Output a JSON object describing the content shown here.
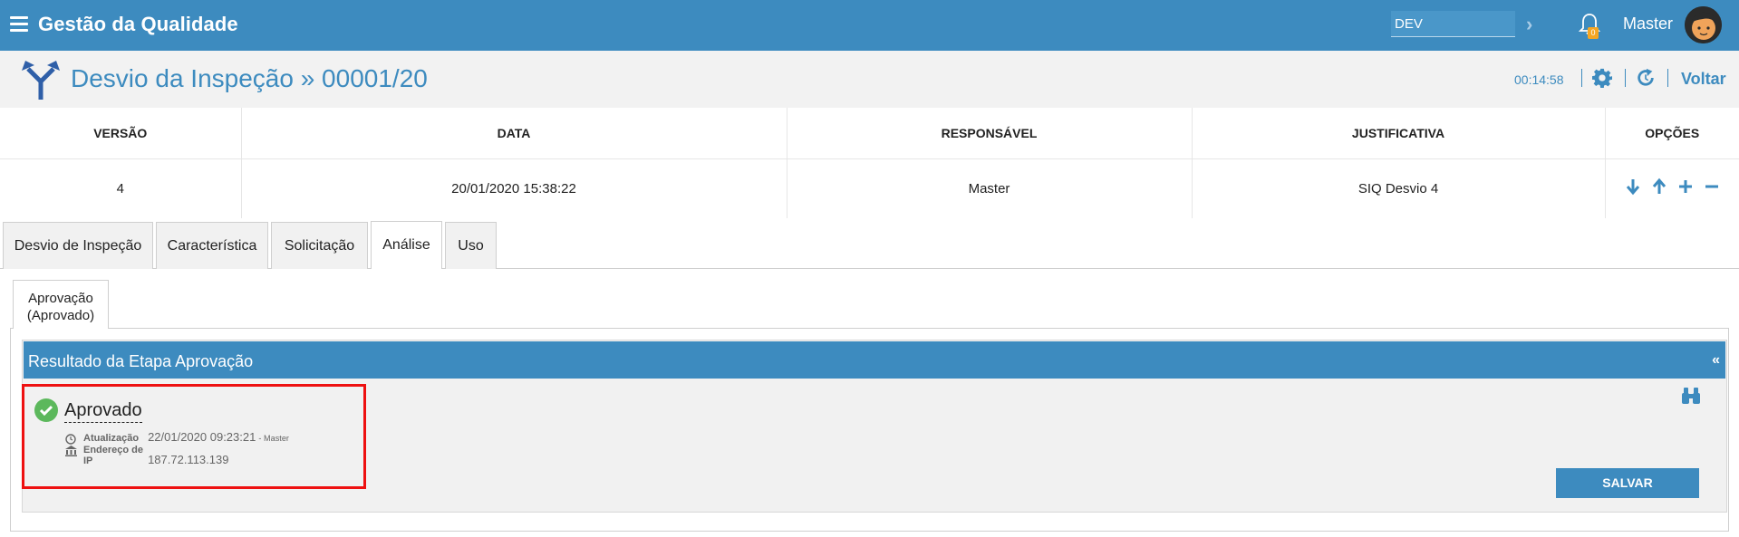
{
  "header": {
    "app_title": "Gestão da Qualidade",
    "environment": "DEV",
    "notification_count": "0",
    "user_name": "Master"
  },
  "page": {
    "title": "Desvio da Inspeção » 00001/20",
    "timer": "00:14:58",
    "back_label": "Voltar"
  },
  "versions_table": {
    "columns": [
      "VERSÃO",
      "DATA",
      "RESPONSÁVEL",
      "JUSTIFICATIVA",
      "OPÇÕES"
    ],
    "rows": [
      {
        "version": "4",
        "date": "20/01/2020 15:38:22",
        "responsible": "Master",
        "justification": "SIQ Desvio 4"
      }
    ]
  },
  "tabs": [
    {
      "label": "Desvio de Inspeção",
      "active": false
    },
    {
      "label": "Característica",
      "active": false
    },
    {
      "label": "Solicitação",
      "active": false
    },
    {
      "label": "Análise",
      "active": true
    },
    {
      "label": "Uso",
      "active": false
    }
  ],
  "subtab": {
    "line1": "Aprovação",
    "line2": "(Aprovado)"
  },
  "result": {
    "title": "Resultado da Etapa Aprovação",
    "collapse_label": "«",
    "status": "Aprovado",
    "update_label": "Atualização",
    "update_value": "22/01/2020 09:23:21",
    "update_user": "- Master",
    "ip_label": "Endereço de IP",
    "ip_value": "187.72.113.139",
    "save_label": "SALVAR"
  },
  "colors": {
    "primary": "#3d8bbf",
    "success": "#5cb85c",
    "highlight": "#ee1111",
    "badge": "#f5a623"
  },
  "icons": [
    "menu-icon",
    "chevron-right-icon",
    "bell-icon",
    "avatar",
    "fork-arrow-icon",
    "gear-icon",
    "refresh-icon",
    "arrow-down-icon",
    "arrow-up-icon",
    "plus-icon",
    "minus-icon",
    "check-circle-icon",
    "clock-icon",
    "bank-icon",
    "binoculars-icon"
  ]
}
